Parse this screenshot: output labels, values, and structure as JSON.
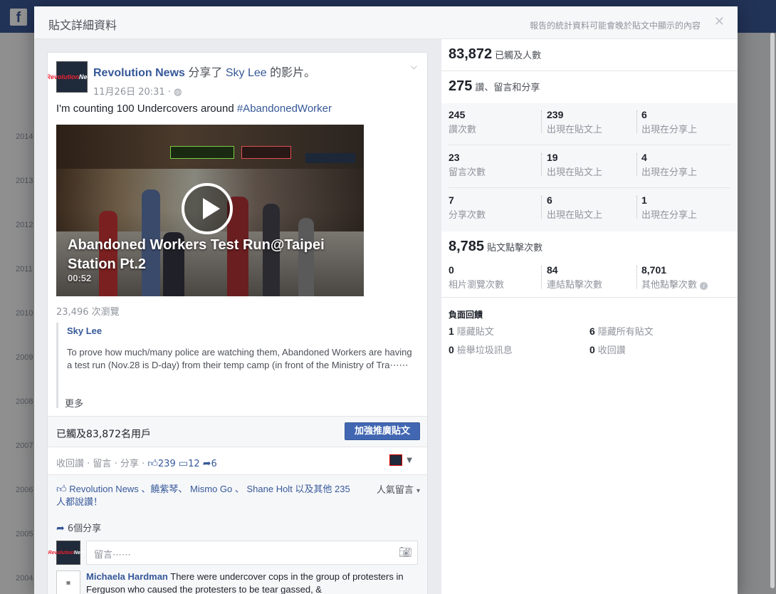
{
  "dialog": {
    "title": "貼文詳細資料",
    "note": "報告的統計資料可能會晚於貼文中顯示的內容",
    "close": "✕"
  },
  "post": {
    "page_name": "Revolution News",
    "shared_verb": "分享了",
    "shared_from": "Sky Lee",
    "shared_suffix": "的影片。",
    "time": "11月26日 20:31 · ",
    "text_prefix": "I'm counting 100 Undercovers around ",
    "hashtag": "#AbandonedWorker",
    "video_title": "Abandoned Workers Test Run@Taipei Station Pt.2",
    "video_duration": "00:52",
    "views": "23,496 次瀏覽",
    "shared_name": "Sky Lee",
    "shared_desc": "To prove how much/many police are watching them, Abandoned Workers are having a test run (Nov.28 is D-day) from their temp camp (in front of the Ministry of Tra⋯⋯",
    "more": "更多",
    "reach_text": "已觸及83,872名用戶",
    "boost_label": "加強推廣貼文",
    "action_unlike": "收回讚",
    "action_comment": "留言",
    "action_share": "分享",
    "like_count": "239",
    "comment_count": "12",
    "share_count": "6",
    "likers": "Revolution News 、饒紫琴、 Mismo Go 、 Shane Holt 以及其他 235 人都說讚！",
    "sort_label": "人氣留言",
    "shares_line": "6個分享",
    "comment_placeholder": "留言⋯⋯",
    "commenter": "Michaela Hardman",
    "comment_text": " There were undercover cops in the group of protesters in Ferguson who caused the protesters to be tear gassed, &"
  },
  "stats": {
    "reach": "83,872",
    "reach_label": "已觸及人數",
    "engage": "275",
    "engage_label": "讚、留言和分享",
    "rows": [
      {
        "total": "245",
        "total_label": "讚次數",
        "on_post": "239",
        "on_post_label": "出現在貼文上",
        "on_share": "6",
        "on_share_label": "出現在分享上"
      },
      {
        "total": "23",
        "total_label": "留言次數",
        "on_post": "19",
        "on_post_label": "出現在貼文上",
        "on_share": "4",
        "on_share_label": "出現在分享上"
      },
      {
        "total": "7",
        "total_label": "分享次數",
        "on_post": "6",
        "on_post_label": "出現在貼文上",
        "on_share": "1",
        "on_share_label": "出現在分享上"
      }
    ],
    "clicks": "8,785",
    "clicks_label": "貼文點擊次數",
    "photo_views": "0",
    "photo_views_label": "相片瀏覽次數",
    "link_clicks": "84",
    "link_clicks_label": "連結點擊次數",
    "other_clicks": "8,701",
    "other_clicks_label": "其他點擊次數",
    "negative_title": "負面回饋",
    "hide_post": "1",
    "hide_post_label": "隱藏貼文",
    "hide_all": "6",
    "hide_all_label": "隱藏所有貼文",
    "report_spam": "0",
    "report_spam_label": "檢舉垃圾訊息",
    "unlike_page": "0",
    "unlike_page_label": "收回讚"
  },
  "background": {
    "years": [
      "2014",
      "2013",
      "2012",
      "2011",
      "2010",
      "2009",
      "2008",
      "2007",
      "2006",
      "2005",
      "2004"
    ]
  }
}
